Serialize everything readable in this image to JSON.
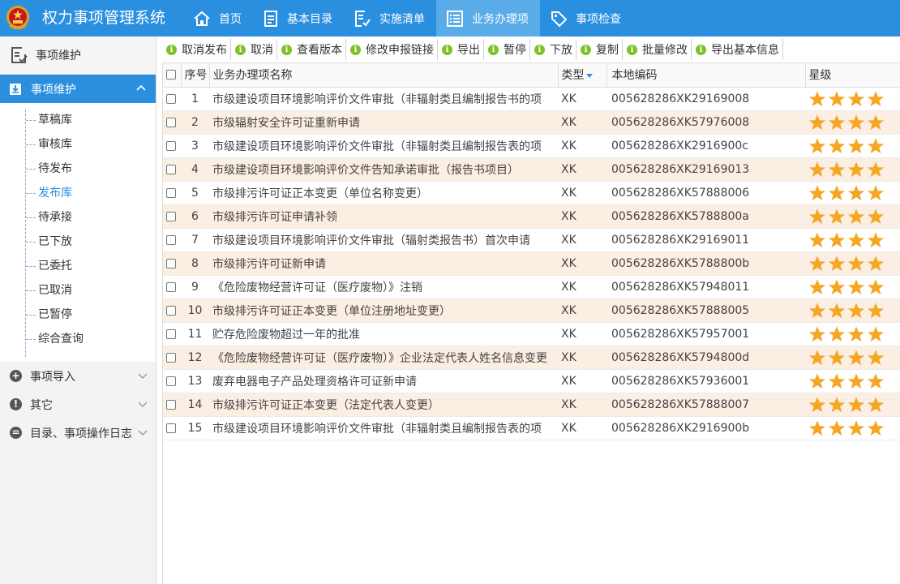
{
  "app": {
    "title": "权力事项管理系统"
  },
  "nav": [
    {
      "label": "首页",
      "icon": "home-icon",
      "active": false
    },
    {
      "label": "基本目录",
      "icon": "catalog-icon",
      "active": false
    },
    {
      "label": "实施清单",
      "icon": "checklist-icon",
      "active": false
    },
    {
      "label": "业务办理项",
      "icon": "list-icon",
      "active": true
    },
    {
      "label": "事项检查",
      "icon": "tag-icon",
      "active": false
    }
  ],
  "sidebar": {
    "top_label": "事项维护",
    "active_group": "事项维护",
    "sub_items": [
      "草稿库",
      "审核库",
      "待发布",
      "发布库",
      "待承接",
      "已下放",
      "已委托",
      "已取消",
      "已暂停",
      "综合查询"
    ],
    "active_sub": "发布库",
    "groups": [
      {
        "label": "事项导入",
        "icon": "plus-circle-icon",
        "glyph": "+"
      },
      {
        "label": "其它",
        "icon": "alert-circle-icon",
        "glyph": "!"
      },
      {
        "label": "目录、事项操作日志",
        "icon": "minus-circle-icon",
        "glyph": "="
      }
    ]
  },
  "toolbar": [
    "取消发布",
    "取消",
    "查看版本",
    "修改申报链接",
    "导出",
    "暂停",
    "下放",
    "复制",
    "批量修改",
    "导出基本信息"
  ],
  "table": {
    "headers": {
      "seq": "序号",
      "name": "业务办理项名称",
      "type": "类型",
      "code": "本地编码",
      "stars": "星级"
    },
    "rows": [
      {
        "seq": "1",
        "name": "市级建设项目环境影响评价文件审批（非辐射类且编制报告书的项",
        "type": "XK",
        "code": "005628286XK29169008",
        "stars": 4
      },
      {
        "seq": "2",
        "name": "市级辐射安全许可证重新申请",
        "type": "XK",
        "code": "005628286XK57976008",
        "stars": 4
      },
      {
        "seq": "3",
        "name": "市级建设项目环境影响评价文件审批（非辐射类且编制报告表的项",
        "type": "XK",
        "code": "005628286XK2916900c",
        "stars": 4
      },
      {
        "seq": "4",
        "name": "市级建设项目环境影响评价文件告知承诺审批（报告书项目）",
        "type": "XK",
        "code": "005628286XK29169013",
        "stars": 4
      },
      {
        "seq": "5",
        "name": "市级排污许可证正本变更（单位名称变更）",
        "type": "XK",
        "code": "005628286XK57888006",
        "stars": 4
      },
      {
        "seq": "6",
        "name": "市级排污许可证申请补领",
        "type": "XK",
        "code": "005628286XK5788800a",
        "stars": 4
      },
      {
        "seq": "7",
        "name": "市级建设项目环境影响评价文件审批（辐射类报告书）首次申请",
        "type": "XK",
        "code": "005628286XK29169011",
        "stars": 4
      },
      {
        "seq": "8",
        "name": "市级排污许可证新申请",
        "type": "XK",
        "code": "005628286XK5788800b",
        "stars": 4
      },
      {
        "seq": "9",
        "name": "《危险废物经营许可证（医疗废物）》注销",
        "type": "XK",
        "code": "005628286XK57948011",
        "stars": 4
      },
      {
        "seq": "10",
        "name": "市级排污许可证正本变更（单位注册地址变更）",
        "type": "XK",
        "code": "005628286XK57888005",
        "stars": 4
      },
      {
        "seq": "11",
        "name": "贮存危险废物超过一年的批准",
        "type": "XK",
        "code": "005628286XK57957001",
        "stars": 4
      },
      {
        "seq": "12",
        "name": "《危险废物经营许可证（医疗废物）》企业法定代表人姓名信息变更",
        "type": "XK",
        "code": "005628286XK5794800d",
        "stars": 4
      },
      {
        "seq": "13",
        "name": "废弃电器电子产品处理资格许可证新申请",
        "type": "XK",
        "code": "005628286XK57936001",
        "stars": 4
      },
      {
        "seq": "14",
        "name": "市级排污许可证正本变更（法定代表人变更）",
        "type": "XK",
        "code": "005628286XK57888007",
        "stars": 4
      },
      {
        "seq": "15",
        "name": "市级建设项目环境影响评价文件审批（非辐射类且编制报告表的项",
        "type": "XK",
        "code": "005628286XK2916900b",
        "stars": 4
      }
    ]
  },
  "colors": {
    "primary": "#2b8fe0",
    "alt_row": "#fbeee3",
    "star": "#f5a623",
    "toolbar_icon": "#7cc225"
  }
}
